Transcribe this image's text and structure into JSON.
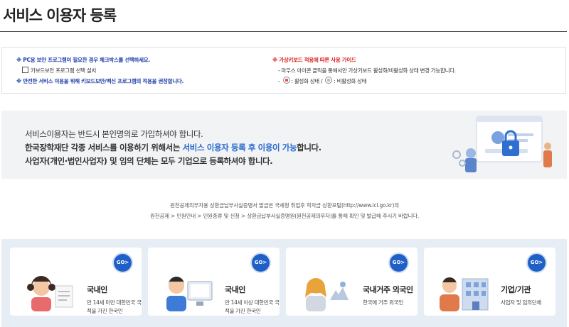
{
  "page_title": "서비스 이용자 등록",
  "notice": {
    "left": {
      "line1": "※ PC용 보안 프로그램이 필요한 경우 체크박스를 선택하세요.",
      "checkbox_label": "키보드보안 프로그램 선택 설치",
      "line3": "※ 안전한 서비스 이용을 위해 키보드보안/백신 프로그램의 적용을 권장합니다."
    },
    "right": {
      "heading": "※ 가상키보드 적용에 따른 사용 가이드",
      "line2": "- 마우스 아이콘 클릭을 통해서만 가상키보드 활성화/비활성화 상태 변경 가능합니다.",
      "dash": "-",
      "active_label": ": 활성화 상태 /",
      "inactive_label": ": 비활성화 상태"
    }
  },
  "banner": {
    "line1": "서비스이용자는 반드시 본인명의로 가입하셔야 합니다.",
    "line2_pre": "한국장학재단 각종 서비스를 이용하기 위해서는 ",
    "line2_highlight": "서비스 이용자 등록 후 이용이 가능",
    "line2_post": "합니다.",
    "line3": "사업자(개인·법인사업자) 및 임의 단체는 모두 기업으로 등록하셔야 합니다."
  },
  "info": {
    "line1": "원천공제의무자용 상환금납부사실증명서 발급은 국세청 취업후 학자금 상환포털(http://www.icl.go.kr)의",
    "line2": "원천공제 > 민원안내 > 민원종류 및 신청 > 상환금납부사실증명원(원천공제의무자)를 통해 확인 및 발급해 주시기 바랍니다."
  },
  "cards": [
    {
      "name": "국내인",
      "desc": "만 14세 미만 대한민국 국적을 가진 한국인",
      "go": "GO>"
    },
    {
      "name": "국내인",
      "desc": "만 14세 이상 대한민국 국적을 가진 한국인",
      "go": "GO>"
    },
    {
      "name": "국내거주 외국인",
      "desc": "한국에 거주 외국인",
      "go": "GO>"
    },
    {
      "name": "기업/기관",
      "desc": "사업자 및 임의단체",
      "go": "GO>"
    }
  ],
  "colors": {
    "accent": "#1f5fc8",
    "notice_blue": "#1f3fa8",
    "highlight": "#2a6ad0"
  }
}
